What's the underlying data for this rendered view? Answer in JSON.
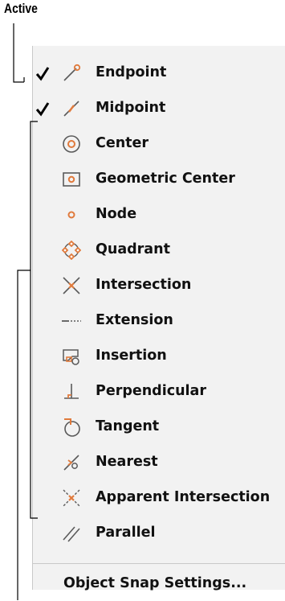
{
  "callout": {
    "active_label": "Active"
  },
  "menu": {
    "items": [
      {
        "label": "Endpoint",
        "checked": true,
        "icon": "endpoint-icon"
      },
      {
        "label": "Midpoint",
        "checked": true,
        "icon": "midpoint-icon"
      },
      {
        "label": "Center",
        "checked": false,
        "icon": "center-icon"
      },
      {
        "label": "Geometric Center",
        "checked": false,
        "icon": "geometric-center-icon"
      },
      {
        "label": "Node",
        "checked": false,
        "icon": "node-icon"
      },
      {
        "label": "Quadrant",
        "checked": false,
        "icon": "quadrant-icon"
      },
      {
        "label": "Intersection",
        "checked": false,
        "icon": "intersection-icon"
      },
      {
        "label": "Extension",
        "checked": false,
        "icon": "extension-icon"
      },
      {
        "label": "Insertion",
        "checked": false,
        "icon": "insertion-icon"
      },
      {
        "label": "Perpendicular",
        "checked": false,
        "icon": "perpendicular-icon"
      },
      {
        "label": "Tangent",
        "checked": false,
        "icon": "tangent-icon"
      },
      {
        "label": "Nearest",
        "checked": false,
        "icon": "nearest-icon"
      },
      {
        "label": "Apparent Intersection",
        "checked": false,
        "icon": "apparent-intersection-icon"
      },
      {
        "label": "Parallel",
        "checked": false,
        "icon": "parallel-icon"
      }
    ],
    "settings_label": "Object Snap Settings...",
    "colors": {
      "accent": "#e07a3c",
      "icon_gray": "#5a5a5a",
      "menu_bg": "#f2f2f2"
    }
  }
}
